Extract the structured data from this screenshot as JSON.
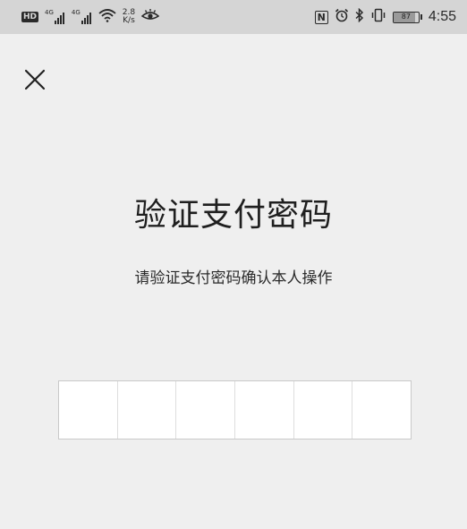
{
  "status_bar": {
    "hd": "HD",
    "signal1_net": "4G",
    "signal2_net": "4G",
    "speed_value": "2.8",
    "speed_unit": "K/s",
    "battery_level": "87",
    "time": "4:55",
    "nfc": "N",
    "icons": [
      "wifi-icon",
      "eye-icon",
      "nfc-icon",
      "alarm-icon",
      "bluetooth-icon",
      "vibrate-icon",
      "battery-icon"
    ]
  },
  "header": {
    "close_icon": "close-icon"
  },
  "main": {
    "title": "验证支付密码",
    "subtitle": "请验证支付密码确认本人操作"
  },
  "pin": {
    "cells": [
      "",
      "",
      "",
      "",
      "",
      ""
    ],
    "length": 6
  },
  "colors": {
    "background": "#efefef",
    "status_bar": "#d5d5d5",
    "input_bg": "#ffffff",
    "text": "#1f1f1f"
  }
}
